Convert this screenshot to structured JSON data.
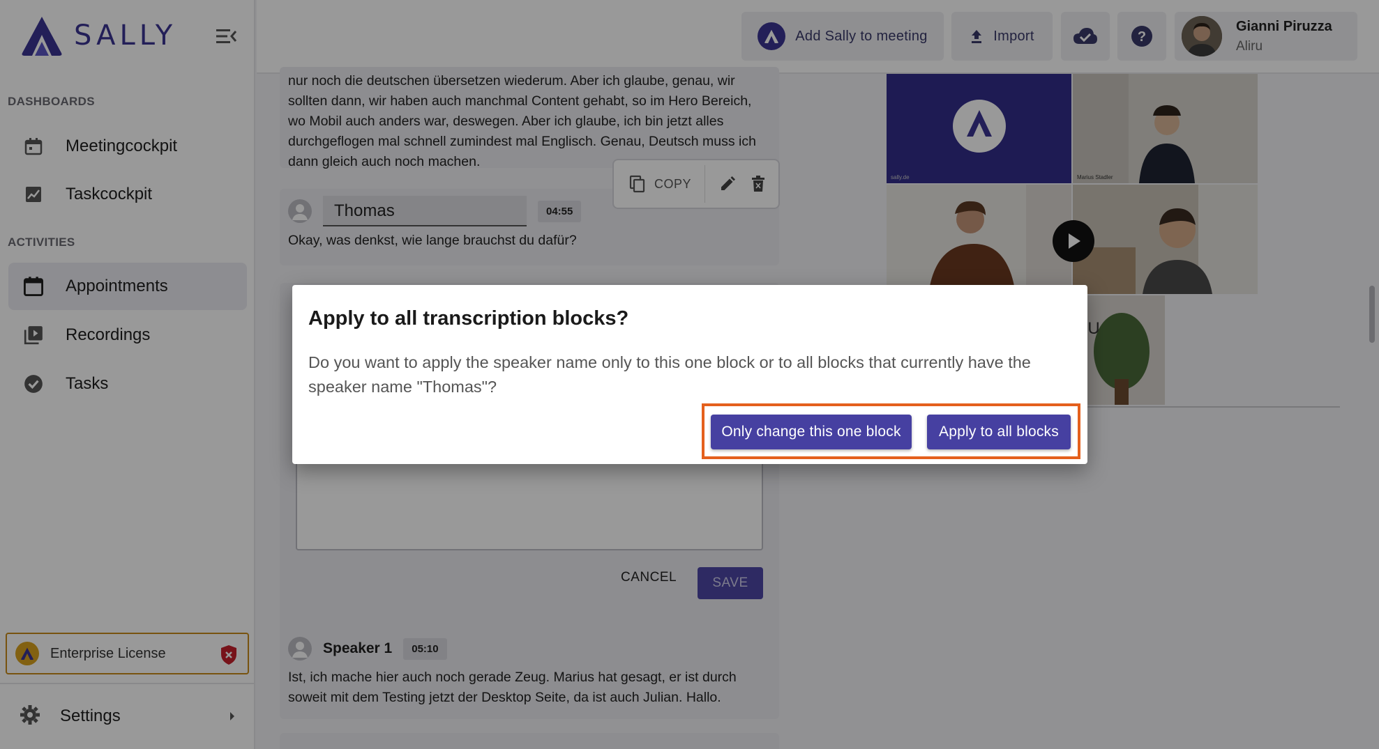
{
  "app": {
    "brand": "SALLY",
    "brand_color": "#3b3493"
  },
  "sidebar": {
    "sections": [
      {
        "label": "DASHBOARDS"
      },
      {
        "label": "ACTIVITIES"
      }
    ],
    "items": [
      {
        "label": "Meetingcockpit",
        "icon": "calendar-icon"
      },
      {
        "label": "Taskcockpit",
        "icon": "chart-icon"
      },
      {
        "label": "Appointments",
        "icon": "calendar-icon",
        "active": true
      },
      {
        "label": "Recordings",
        "icon": "video-library-icon"
      },
      {
        "label": "Tasks",
        "icon": "check-circle-icon"
      }
    ],
    "license": {
      "label": "Enterprise License",
      "accent": "#d9a21e"
    },
    "settings": {
      "label": "Settings"
    }
  },
  "topbar": {
    "add_sally_label": "Add Sally to meeting",
    "import_label": "Import",
    "user": {
      "name": "Gianni Piruzza",
      "org": "Aliru"
    }
  },
  "transcript": {
    "blocks": [
      {
        "text": "nur noch die deutschen übersetzen wiederum. Aber ich glaube, genau, wir sollten dann, wir haben auch manchmal Content gehabt, so im Hero Bereich, wo Mobil auch anders war, deswegen. Aber ich glaube, ich bin jetzt alles durchgeflogen mal schnell zumindest mal Englisch. Genau, Deutsch muss ich dann gleich auch noch machen."
      },
      {
        "speaker": "Thomas",
        "time": "04:55",
        "text": "Okay, was denkst, wie lange brauchst du dafür?"
      },
      {
        "speaker": "Speaker 1",
        "time": "05:10",
        "text": "Ist, ich mache hier auch noch gerade Zeug. Marius hat gesagt, er ist durch soweit mit dem Testing jetzt der Desktop Seite, da ist auch Julian. Hallo."
      }
    ],
    "toolbar": {
      "copy_label": "COPY"
    },
    "edit": {
      "cancel_label": "CANCEL",
      "save_label": "SAVE"
    }
  },
  "video": {
    "tiles": [
      {
        "caption": "sally.de"
      },
      {
        "caption": "Marius Stadler"
      },
      {
        "caption": ""
      },
      {
        "caption": ""
      },
      {
        "caption": "RU"
      }
    ]
  },
  "dialog": {
    "title": "Apply to all transcription blocks?",
    "body": "Do you want to apply the speaker name only to this one block or to all blocks that currently have the speaker name \"Thomas\"?",
    "only_this_label": "Only change this one block",
    "apply_all_label": "Apply to all blocks",
    "highlight_color": "#e4601d"
  }
}
